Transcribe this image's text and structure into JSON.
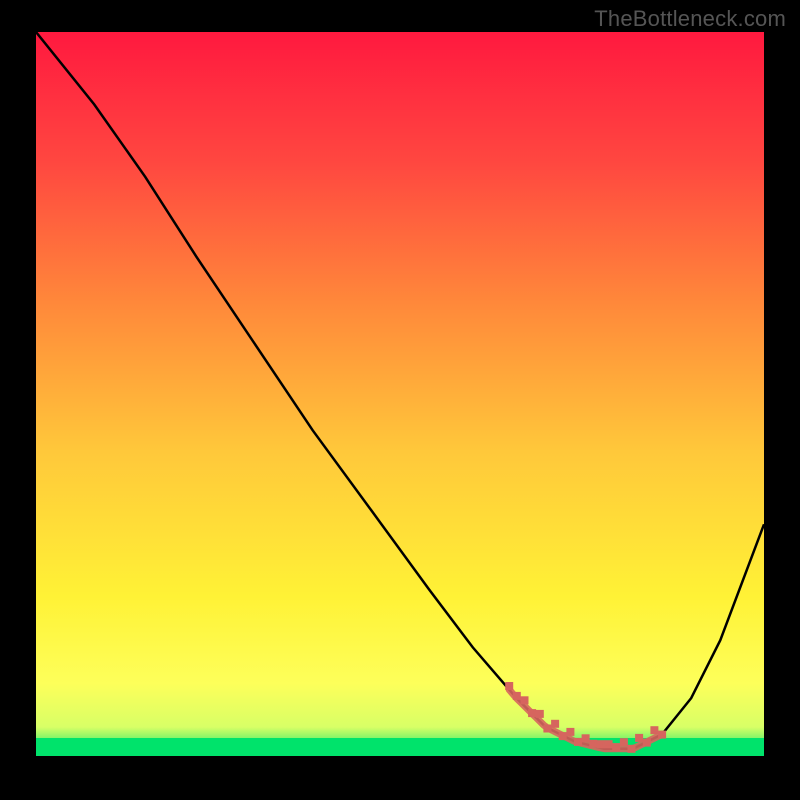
{
  "watermark": "TheBottleneck.com",
  "chart_data": {
    "type": "line",
    "title": "",
    "xlabel": "",
    "ylabel": "",
    "xlim": [
      0,
      100
    ],
    "ylim": [
      0,
      100
    ],
    "series": [
      {
        "name": "curve",
        "color": "#000000",
        "x": [
          0,
          8,
          15,
          22,
          30,
          38,
          46,
          54,
          60,
          66,
          70,
          74,
          78,
          82,
          86,
          90,
          94,
          100
        ],
        "y": [
          100,
          90,
          80,
          69,
          57,
          45,
          34,
          23,
          15,
          8,
          4,
          2,
          1,
          1,
          3,
          8,
          16,
          32
        ]
      }
    ],
    "highlight_band": {
      "x_start": 65,
      "x_end": 86,
      "color": "#d6655e"
    },
    "bottom_band_color": "#00e36b",
    "gradient_stops": [
      {
        "offset": 0,
        "color": "#ff193f"
      },
      {
        "offset": 18,
        "color": "#ff4740"
      },
      {
        "offset": 38,
        "color": "#ff8a3a"
      },
      {
        "offset": 58,
        "color": "#ffc83a"
      },
      {
        "offset": 78,
        "color": "#fff236"
      },
      {
        "offset": 90,
        "color": "#fdff5a"
      },
      {
        "offset": 96,
        "color": "#d8ff66"
      },
      {
        "offset": 100,
        "color": "#00e36b"
      }
    ]
  }
}
